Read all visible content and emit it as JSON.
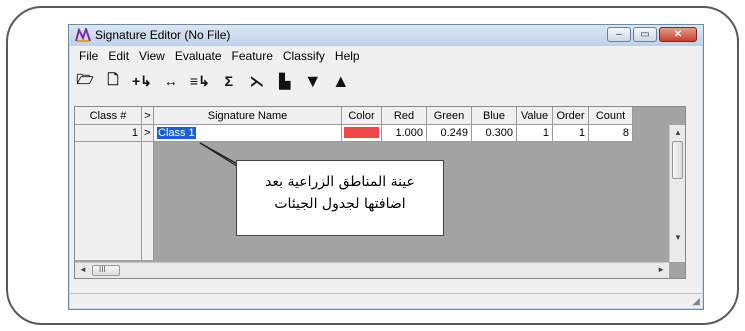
{
  "window": {
    "title": "Signature Editor (No File)",
    "controls": [
      "minimize",
      "maximize",
      "close"
    ]
  },
  "menu": [
    "File",
    "Edit",
    "View",
    "Evaluate",
    "Feature",
    "Classify",
    "Help"
  ],
  "toolbar": {
    "icons": [
      "open-folder-icon",
      "new-document-icon",
      "add-row-icon",
      "replace-icon",
      "merge-icon",
      "statistics-sigma-icon",
      "feature-space-icon",
      "histogram-icon",
      "sort-down-icon",
      "sort-up-icon"
    ],
    "glyphs": [
      "🗁",
      "🗋",
      "+↳",
      "↔",
      "≡↳",
      "Σ",
      "⋋",
      "▙",
      "▼",
      "▲"
    ]
  },
  "table": {
    "columns": [
      "Class #",
      ">",
      "Signature Name",
      "Color",
      "Red",
      "Green",
      "Blue",
      "Value",
      "Order",
      "Count"
    ],
    "rows": [
      {
        "class_num": "1",
        "marker": ">",
        "name": "Class 1",
        "color": "#f04848",
        "red": "1.000",
        "green": "0.249",
        "blue": "0.300",
        "value": "1",
        "order": "1",
        "count": "8"
      }
    ]
  },
  "annotation": {
    "line1": "عينة المناطق الزراعية بعد",
    "line2": "اضافتها لجدول الجيئات"
  },
  "scroll_labels": {
    "up": "▲",
    "down": "▼",
    "left": "◄",
    "right": "►",
    "thumb": "III"
  }
}
